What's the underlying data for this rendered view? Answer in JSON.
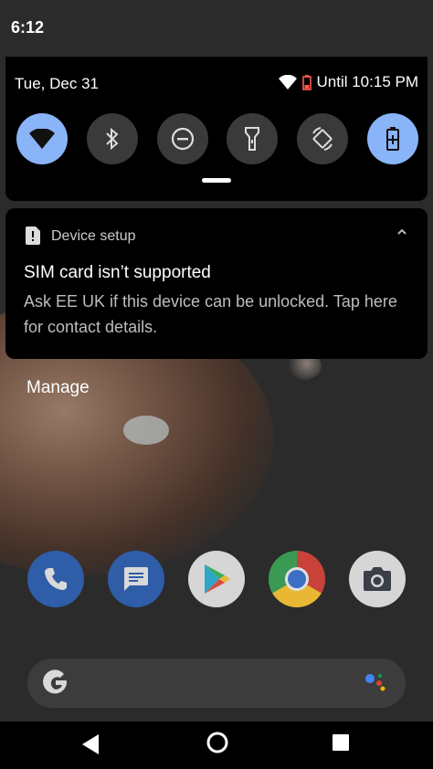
{
  "status_bar": {
    "time": "6:12"
  },
  "quick_settings": {
    "date": "Tue, Dec 31",
    "battery_text": "Until 10:15 PM",
    "tiles": [
      {
        "name": "wifi",
        "active": true
      },
      {
        "name": "bluetooth",
        "active": false
      },
      {
        "name": "do-not-disturb",
        "active": false
      },
      {
        "name": "flashlight",
        "active": false
      },
      {
        "name": "auto-rotate",
        "active": false
      },
      {
        "name": "battery-saver",
        "active": true
      }
    ],
    "active_color": "#8ab4f8"
  },
  "notification": {
    "app_name": "Device setup",
    "title": "SIM card isn’t supported",
    "body": "Ask EE UK if this device can be unlocked. Tap here for contact details."
  },
  "manage_label": "Manage",
  "dock": {
    "apps": [
      "phone",
      "messages",
      "play-store",
      "chrome",
      "camera"
    ]
  },
  "search_bar": {
    "icons": [
      "google-g-icon",
      "assistant-icon"
    ]
  },
  "nav_bar": {
    "buttons": [
      "back",
      "home",
      "recents"
    ]
  }
}
